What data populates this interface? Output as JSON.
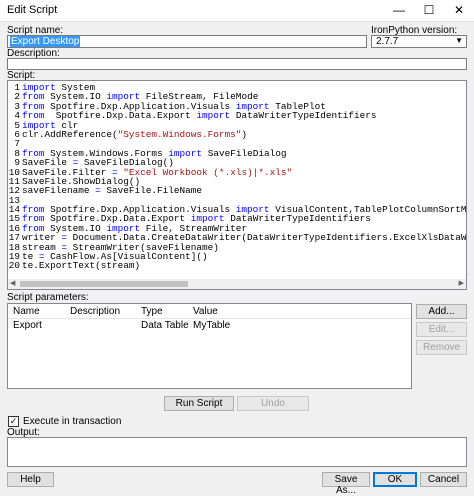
{
  "window": {
    "title": "Edit Script",
    "minimize": "—",
    "maximize": "☐",
    "close": "✕"
  },
  "script_name": {
    "label": "Script name:",
    "value": "Export Desktop"
  },
  "ironpython": {
    "label": "IronPython version:",
    "value": "2.7.7"
  },
  "description": {
    "label": "Description:",
    "value": ""
  },
  "script": {
    "label": "Script:",
    "lines": [
      {
        "n": "1",
        "parts": [
          [
            "kw",
            "import"
          ],
          [
            "t",
            " System"
          ]
        ]
      },
      {
        "n": "2",
        "parts": [
          [
            "kw",
            "from"
          ],
          [
            "t",
            " System.IO "
          ],
          [
            "kw",
            "import"
          ],
          [
            "t",
            " FileStream, FileMode"
          ]
        ]
      },
      {
        "n": "3",
        "parts": [
          [
            "kw",
            "from"
          ],
          [
            "t",
            " Spotfire.Dxp.Application.Visuals "
          ],
          [
            "kw",
            "import"
          ],
          [
            "t",
            " TablePlot"
          ]
        ]
      },
      {
        "n": "4",
        "parts": [
          [
            "kw",
            "from"
          ],
          [
            "t",
            "  Spotfire.Dxp.Data.Export "
          ],
          [
            "kw",
            "import"
          ],
          [
            "t",
            " DataWriterTypeIdentifiers"
          ]
        ]
      },
      {
        "n": "5",
        "parts": [
          [
            "kw",
            "import"
          ],
          [
            "t",
            " clr"
          ]
        ]
      },
      {
        "n": "6",
        "parts": [
          [
            "t",
            "clr.AddReference("
          ],
          [
            "str",
            "\"System.Windows.Forms\""
          ],
          [
            "t",
            ")"
          ]
        ]
      },
      {
        "n": "7",
        "parts": []
      },
      {
        "n": "8",
        "parts": [
          [
            "kw",
            "from"
          ],
          [
            "t",
            " System.Windows.Forms "
          ],
          [
            "kw",
            "import"
          ],
          [
            "t",
            " SaveFileDialog"
          ]
        ]
      },
      {
        "n": "9",
        "parts": [
          [
            "t",
            "SaveFile "
          ],
          [
            "kw",
            "="
          ],
          [
            "t",
            " SaveFileDialog()"
          ]
        ]
      },
      {
        "n": "10",
        "parts": [
          [
            "t",
            "SaveFile.Filter "
          ],
          [
            "kw",
            "="
          ],
          [
            "t",
            " "
          ],
          [
            "str",
            "\"Excel Workbook (*.xls)|*.xls\""
          ]
        ]
      },
      {
        "n": "11",
        "parts": [
          [
            "t",
            "SaveFile.ShowDialog()"
          ]
        ]
      },
      {
        "n": "12",
        "parts": [
          [
            "t",
            "saveFilename "
          ],
          [
            "kw",
            "="
          ],
          [
            "t",
            " SaveFile.FileName"
          ]
        ]
      },
      {
        "n": "13",
        "parts": []
      },
      {
        "n": "14",
        "parts": [
          [
            "kw",
            "from"
          ],
          [
            "t",
            " Spotfire.Dxp.Application.Visuals "
          ],
          [
            "kw",
            "import"
          ],
          [
            "t",
            " VisualContent,TablePlotColumnSortMode"
          ]
        ]
      },
      {
        "n": "15",
        "parts": [
          [
            "kw",
            "from"
          ],
          [
            "t",
            " Spotfire.Dxp.Data.Export "
          ],
          [
            "kw",
            "import"
          ],
          [
            "t",
            " DataWriterTypeIdentifiers"
          ]
        ]
      },
      {
        "n": "16",
        "parts": [
          [
            "kw",
            "from"
          ],
          [
            "t",
            " System.IO "
          ],
          [
            "kw",
            "import"
          ],
          [
            "t",
            " File, StreamWriter"
          ]
        ]
      },
      {
        "n": "17",
        "parts": [
          [
            "t",
            "writer "
          ],
          [
            "kw",
            "="
          ],
          [
            "t",
            " Document.Data.CreateDataWriter(DataWriterTypeIdentifiers.ExcelXlsDataWriter)"
          ]
        ]
      },
      {
        "n": "18",
        "parts": [
          [
            "t",
            "stream "
          ],
          [
            "kw",
            "="
          ],
          [
            "t",
            " StreamWriter(saveFilename)"
          ]
        ]
      },
      {
        "n": "19",
        "parts": [
          [
            "t",
            "te "
          ],
          [
            "kw",
            "="
          ],
          [
            "t",
            " CashFlow.As[VisualContent]()"
          ]
        ]
      },
      {
        "n": "20",
        "parts": [
          [
            "t",
            "te.ExportText(stream)"
          ]
        ]
      }
    ]
  },
  "params": {
    "label": "Script parameters:",
    "headers": [
      "Name",
      "Description",
      "Type",
      "Value"
    ],
    "rows": [
      [
        "Export",
        "",
        "Data Table",
        "MyTable"
      ]
    ],
    "add": "Add...",
    "edit": "Edit...",
    "remove": "Remove"
  },
  "run_script": "Run Script",
  "undo": "Undo",
  "execute": {
    "label": "Execute in transaction",
    "checked": true,
    "mark": "✓"
  },
  "output": {
    "label": "Output:"
  },
  "help": "Help",
  "save_as": "Save As...",
  "ok": "OK",
  "cancel": "Cancel"
}
